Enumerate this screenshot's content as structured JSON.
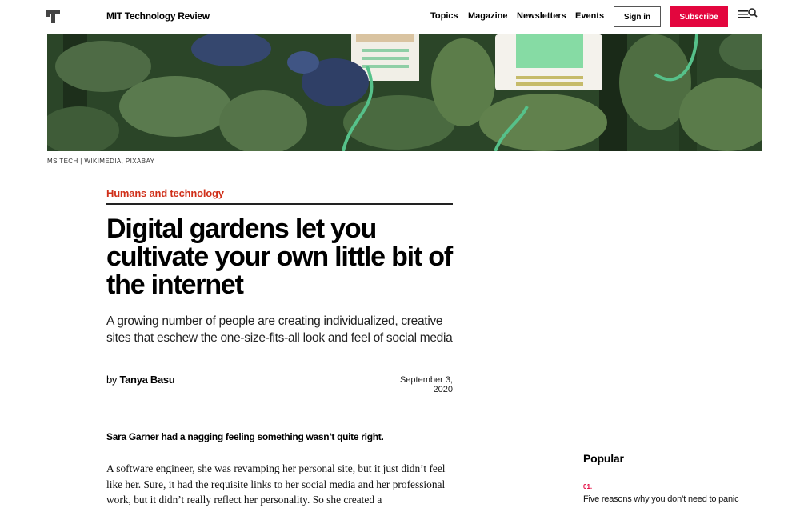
{
  "header": {
    "brand": "MIT Technology Review",
    "nav": [
      "Topics",
      "Magazine",
      "Newsletters",
      "Events"
    ],
    "signin_label": "Sign in",
    "subscribe_label": "Subscribe"
  },
  "hero": {
    "caption": "MS TECH | WIKIMEDIA, PIXABAY"
  },
  "article": {
    "topic": "Humans and technology",
    "headline": "Digital gardens let you cultivate your own little bit of the internet",
    "dek": "A growing number of people are creating individualized, creative sites that eschew the one-size-fits-all look and feel of social media",
    "by_prefix": "by",
    "author": "Tanya Basu",
    "date": "September 3, 2020",
    "lead": "Sara Garner had a nagging feeling something wasn’t quite right.",
    "body": "A software engineer, she was revamping her personal site, but it just didn’t feel like her. Sure, it had the requisite links to her social media and her professional work, but it didn’t really reflect her personality. So she created a"
  },
  "sidebar": {
    "popular_title": "Popular",
    "items": [
      {
        "number": "01.",
        "title": "Five reasons why you don’t need to panic"
      }
    ]
  },
  "colors": {
    "accent": "#e3063e",
    "topic": "#d0301a"
  }
}
